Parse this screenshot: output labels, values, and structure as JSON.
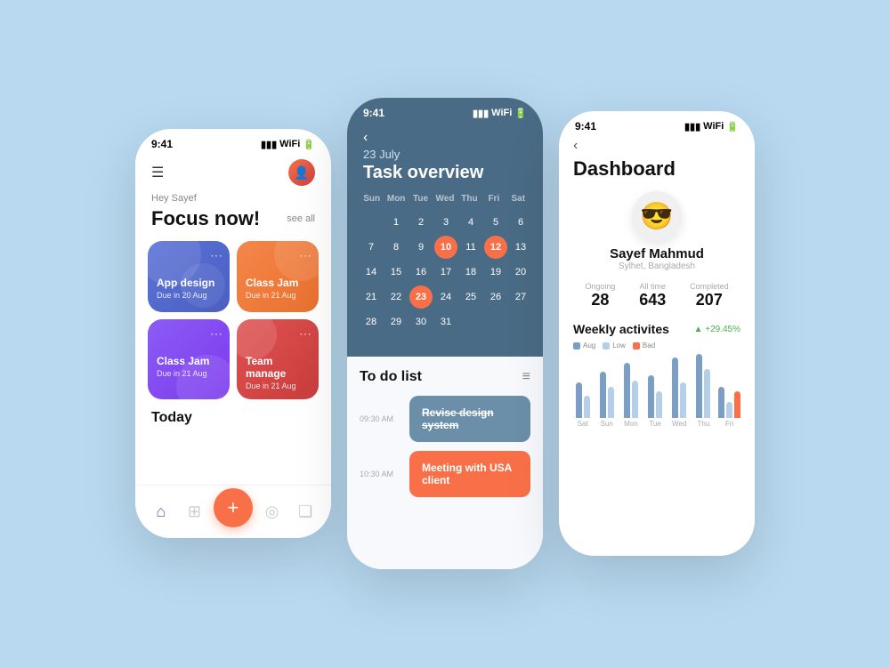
{
  "phone1": {
    "status": {
      "time": "9:41"
    },
    "greeting": "Hey Sayef",
    "title": "Focus now!",
    "see_all": "see all",
    "cards": [
      {
        "title": "App design",
        "due": "Due in 20 Aug",
        "color": "blue"
      },
      {
        "title": "Class Jam",
        "due": "Due in 21 Aug",
        "color": "orange"
      },
      {
        "title": "Class Jam",
        "due": "Due in 21 Aug",
        "color": "purple"
      },
      {
        "title": "Team manage",
        "due": "Due in 21 Aug",
        "color": "red"
      }
    ],
    "today": "Today",
    "nav": [
      "home",
      "calendar",
      "add",
      "settings",
      "bookmark"
    ]
  },
  "phone2": {
    "status": {
      "time": "9:41"
    },
    "back": "‹",
    "date": "23 July",
    "title": "Task overview",
    "days": [
      "Sun",
      "Mon",
      "Tue",
      "Wed",
      "Thu",
      "Fri",
      "Sat"
    ],
    "calendar_rows": [
      [
        "",
        "1",
        "2",
        "3",
        "4",
        "5",
        "6"
      ],
      [
        "7",
        "8",
        "9",
        "10",
        "11",
        "12",
        "13"
      ],
      [
        "14",
        "15",
        "16",
        "17",
        "18",
        "19",
        "20"
      ],
      [
        "21",
        "22",
        "23",
        "24",
        "25",
        "26",
        "27"
      ],
      [
        "28",
        "29",
        "30",
        "31",
        "",
        "",
        ""
      ]
    ],
    "today_date": "23",
    "highlighted": [
      "10",
      "12"
    ],
    "todo_title": "To do list",
    "tasks": [
      {
        "time": "09:30 AM",
        "label": "Revise design system",
        "done": true
      },
      {
        "time": "10:30 AM",
        "label": "Meeting with USA client",
        "done": false
      }
    ]
  },
  "phone3": {
    "status": {
      "time": "9:41"
    },
    "back": "‹",
    "title": "Dashboard",
    "avatar_emoji": "😎",
    "name": "Sayef Mahmud",
    "location": "Sylhet, Bangladesh",
    "stats": [
      {
        "label": "Ongoing",
        "value": "28"
      },
      {
        "label": "All time",
        "value": "643"
      },
      {
        "label": "Completed",
        "value": "207"
      }
    ],
    "weekly_title": "Weekly activites",
    "weekly_change": "▲ +29.45%",
    "legend": [
      {
        "label": "Aug",
        "color": "#7a9ec4"
      },
      {
        "label": "Low",
        "color": "#b5cfe8"
      },
      {
        "label": "Bad",
        "color": "#f97048"
      }
    ],
    "chart_days": [
      "Sat",
      "Sun",
      "Mon",
      "Tue",
      "Wed",
      "Thu",
      "Fri"
    ],
    "chart_data": [
      {
        "aug": 50,
        "low": 30,
        "bad": 0
      },
      {
        "aug": 60,
        "low": 40,
        "bad": 0
      },
      {
        "aug": 70,
        "low": 50,
        "bad": 0
      },
      {
        "aug": 55,
        "low": 35,
        "bad": 0
      },
      {
        "aug": 75,
        "low": 45,
        "bad": 0
      },
      {
        "aug": 80,
        "low": 60,
        "bad": 0
      },
      {
        "aug": 40,
        "low": 20,
        "bad": 35
      }
    ]
  }
}
